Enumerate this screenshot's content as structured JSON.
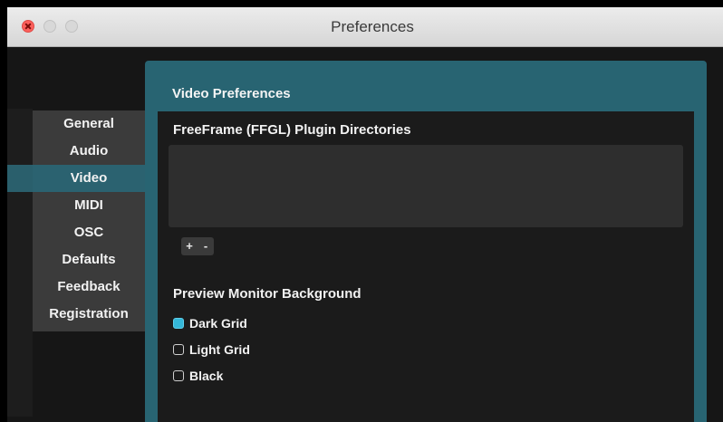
{
  "window": {
    "title": "Preferences"
  },
  "sidebar": {
    "items": [
      {
        "label": "General",
        "active": false
      },
      {
        "label": "Audio",
        "active": false
      },
      {
        "label": "Video",
        "active": true
      },
      {
        "label": "MIDI",
        "active": false
      },
      {
        "label": "OSC",
        "active": false
      },
      {
        "label": "Defaults",
        "active": false
      },
      {
        "label": "Feedback",
        "active": false
      },
      {
        "label": "Registration",
        "active": false
      }
    ]
  },
  "panel": {
    "title": "Video Preferences",
    "plugin_dirs": {
      "heading": "FreeFrame (FFGL) Plugin Directories",
      "add_label": "+",
      "remove_label": "-"
    },
    "preview_bg": {
      "heading": "Preview Monitor Background",
      "options": [
        {
          "label": "Dark Grid",
          "checked": true
        },
        {
          "label": "Light Grid",
          "checked": false
        },
        {
          "label": "Black",
          "checked": false
        }
      ]
    }
  },
  "colors": {
    "accent": "#286472",
    "active_item": "#2b6270",
    "checked": "#34b7d8"
  }
}
